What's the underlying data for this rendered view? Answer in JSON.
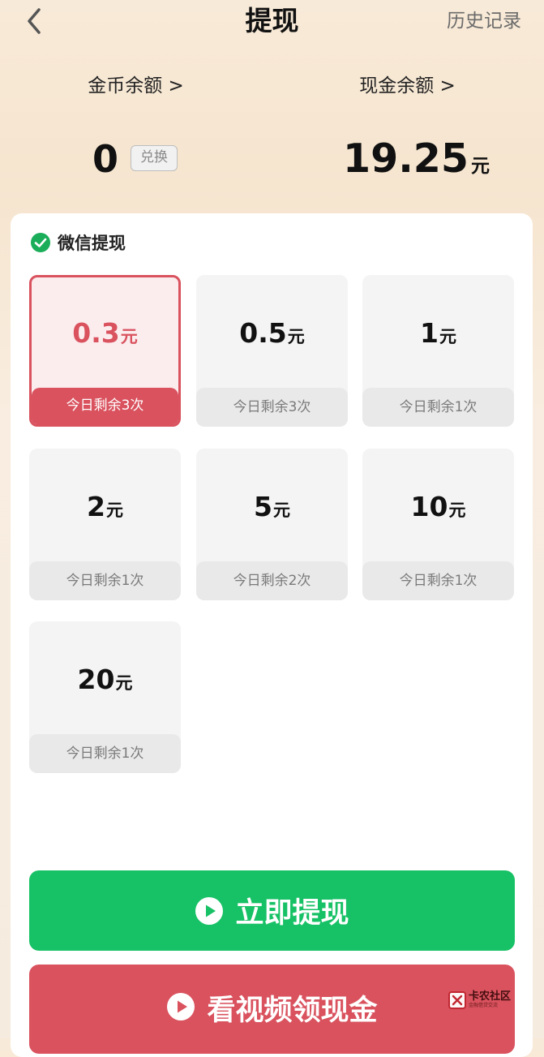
{
  "header": {
    "title": "提现",
    "history_label": "历史记录"
  },
  "balances": {
    "coin_label": "金币余额 >",
    "coin_value": "0",
    "exchange_label": "兑换",
    "cash_label": "现金余额 >",
    "cash_value": "19.25",
    "cash_unit": "元"
  },
  "withdraw_section": {
    "title": "微信提现",
    "options": [
      {
        "amount": "0.3",
        "unit": "元",
        "remain": "今日剩余3次",
        "selected": true
      },
      {
        "amount": "0.5",
        "unit": "元",
        "remain": "今日剩余3次",
        "selected": false
      },
      {
        "amount": "1",
        "unit": "元",
        "remain": "今日剩余1次",
        "selected": false
      },
      {
        "amount": "2",
        "unit": "元",
        "remain": "今日剩余1次",
        "selected": false
      },
      {
        "amount": "5",
        "unit": "元",
        "remain": "今日剩余2次",
        "selected": false
      },
      {
        "amount": "10",
        "unit": "元",
        "remain": "今日剩余1次",
        "selected": false
      },
      {
        "amount": "20",
        "unit": "元",
        "remain": "今日剩余1次",
        "selected": false
      }
    ]
  },
  "actions": {
    "withdraw_label": "立即提现",
    "video_label": "看视频领现金"
  },
  "watermark": {
    "name": "卡农社区",
    "sub": "金融借贷交流"
  },
  "colors": {
    "selected_red": "#d9525e",
    "withdraw_green": "#17c165",
    "wechat_green": "#1aad5a"
  },
  "icons": [
    "back-arrow-icon",
    "wechat-icon",
    "play-icon"
  ]
}
